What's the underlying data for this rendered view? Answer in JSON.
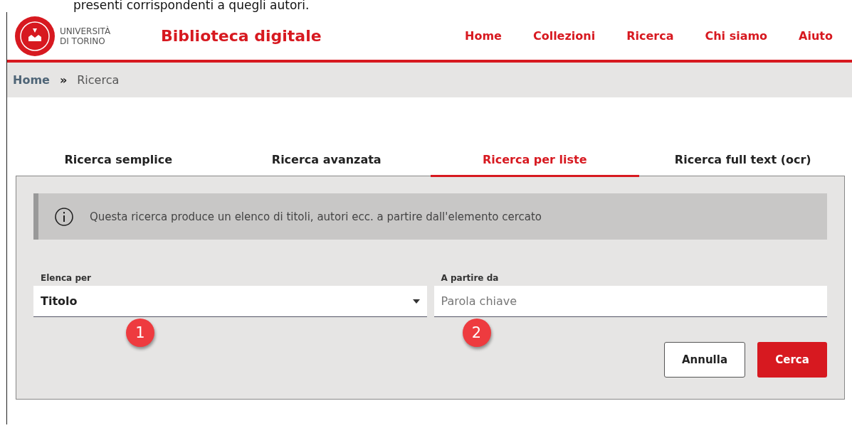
{
  "top_text": "presenti corrispondenti a quegli autori.",
  "header": {
    "logo_line_1": "UNIVERSITÀ",
    "logo_line_2": "DI TORINO",
    "title": "Biblioteca digitale",
    "nav": [
      {
        "label": "Home"
      },
      {
        "label": "Collezioni"
      },
      {
        "label": "Ricerca"
      },
      {
        "label": "Chi siamo"
      },
      {
        "label": "Aiuto"
      }
    ]
  },
  "breadcrumb": {
    "items": [
      "Home",
      "Ricerca"
    ],
    "separator": "»"
  },
  "tabs": [
    {
      "label": "Ricerca semplice",
      "selected": false
    },
    {
      "label": "Ricerca avanzata",
      "selected": false
    },
    {
      "label": "Ricerca per liste",
      "selected": true
    },
    {
      "label": "Ricerca full text (ocr)",
      "selected": false
    }
  ],
  "info": "Questa ricerca produce un elenco di titoli, autori ecc. a partire dall'elemento cercato",
  "fields": [
    {
      "kind": "select",
      "label": "Elenca per",
      "value": "Titolo",
      "badge": "1"
    },
    {
      "kind": "text",
      "label": "A partire da",
      "placeholder": "Parola chiave",
      "badge": "2"
    }
  ],
  "buttons": [
    {
      "label": "Annulla",
      "kind": "secondary"
    },
    {
      "label": "Cerca",
      "kind": "primary"
    }
  ]
}
